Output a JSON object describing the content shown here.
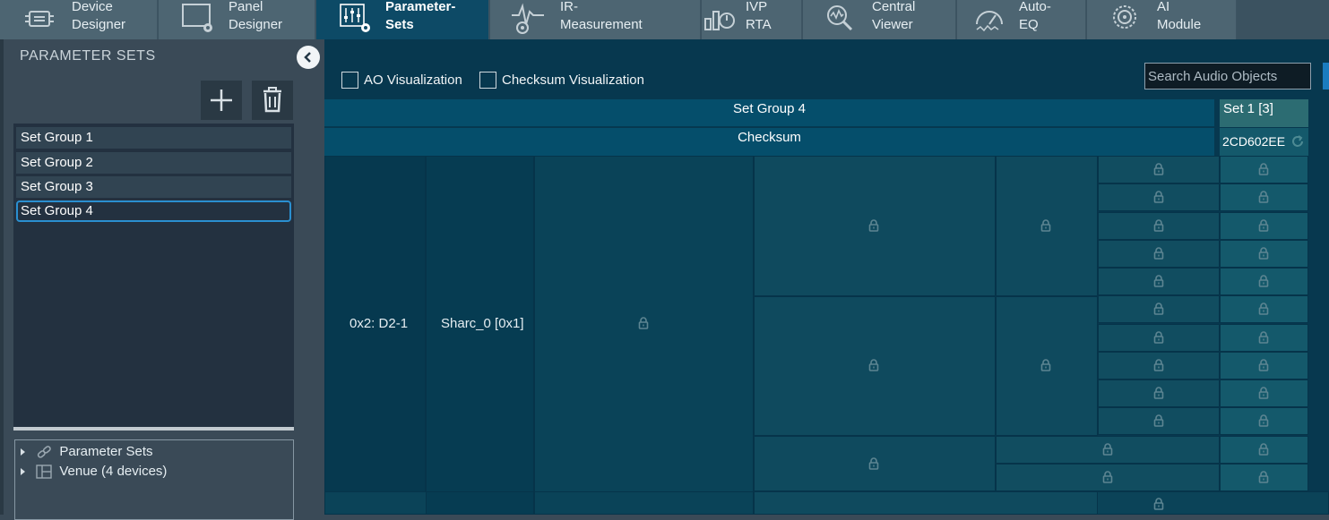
{
  "tabs": [
    {
      "label": "Device\nDesigner",
      "icon": "device-designer-icon"
    },
    {
      "label": "Panel\nDesigner",
      "icon": "panel-designer-icon"
    },
    {
      "label": "Parameter-\nSets",
      "icon": "parameter-sets-icon",
      "active": true
    },
    {
      "label": "IR-\nMeasurement",
      "icon": "ir-measurement-icon"
    },
    {
      "label": "IVP\nRTA",
      "icon": "ivp-rta-icon"
    },
    {
      "label": "Central\nViewer",
      "icon": "central-viewer-icon"
    },
    {
      "label": "Auto-\nEQ",
      "icon": "auto-eq-icon"
    },
    {
      "label": "AI\nModule",
      "icon": "ai-module-icon"
    }
  ],
  "left_panel": {
    "title": "PARAMETER SETS",
    "collapse_icon": "chevron-left-icon",
    "add_icon": "plus-icon",
    "delete_icon": "trash-icon",
    "groups": [
      "Set Group 1",
      "Set Group 2",
      "Set Group 3",
      "Set Group 4"
    ],
    "selected_group": "Set Group 4",
    "tree": [
      {
        "label": "Parameter Sets",
        "icon": "link-icon"
      },
      {
        "label": "Venue (4 devices)",
        "icon": "venue-icon"
      }
    ]
  },
  "toolbar": {
    "ao_visualization_label": "AO Visualization",
    "checksum_visualization_label": "Checksum Visualization",
    "search_placeholder": "Search Audio Objects"
  },
  "table": {
    "group_header": "Set Group 4",
    "checksum_header": "Checksum",
    "set_header": "Set 1 [3]",
    "checksum_value": "2CD602EE",
    "refresh_icon": "refresh-icon",
    "device": "0x2: D2-1",
    "core": "Sharc_0 [0x1]",
    "lock_icon": "lock-icon"
  },
  "colors": {
    "active_tab": "#0d4a66",
    "main_bg": "#07384f",
    "cell_bg": "#0f4a5e",
    "header_bg": "#054e6b",
    "set_cell_bg": "#14596b",
    "selection_border": "#2a8fd0"
  }
}
